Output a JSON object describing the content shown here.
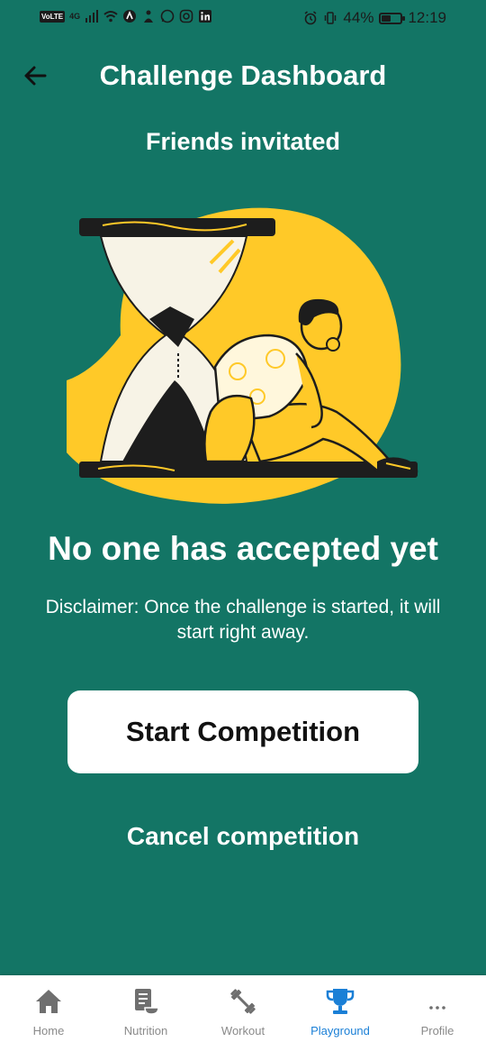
{
  "status_bar": {
    "network_chip": "VoLTE",
    "signal_label": "4G",
    "battery_text": "44%",
    "battery_level": 0.44,
    "time": "12:19"
  },
  "header": {
    "title": "Challenge Dashboard",
    "subtitle": "Friends invitated"
  },
  "main": {
    "headline": "No one has accepted yet",
    "disclaimer": "Disclaimer: Once the challenge is started, it will start right away.",
    "start_button": "Start Competition",
    "cancel_link": "Cancel competition"
  },
  "bottom_nav": {
    "items": [
      {
        "label": "Home",
        "icon": "home-icon"
      },
      {
        "label": "Nutrition",
        "icon": "nutrition-icon"
      },
      {
        "label": "Workout",
        "icon": "dumbbell-icon"
      },
      {
        "label": "Playground",
        "icon": "trophy-icon"
      },
      {
        "label": "Profile",
        "icon": "more-dots-icon"
      }
    ],
    "active": "Playground"
  },
  "colors": {
    "background": "#137565",
    "illustration_yellow": "#FFC928",
    "active_tab": "#1a7fd6"
  }
}
